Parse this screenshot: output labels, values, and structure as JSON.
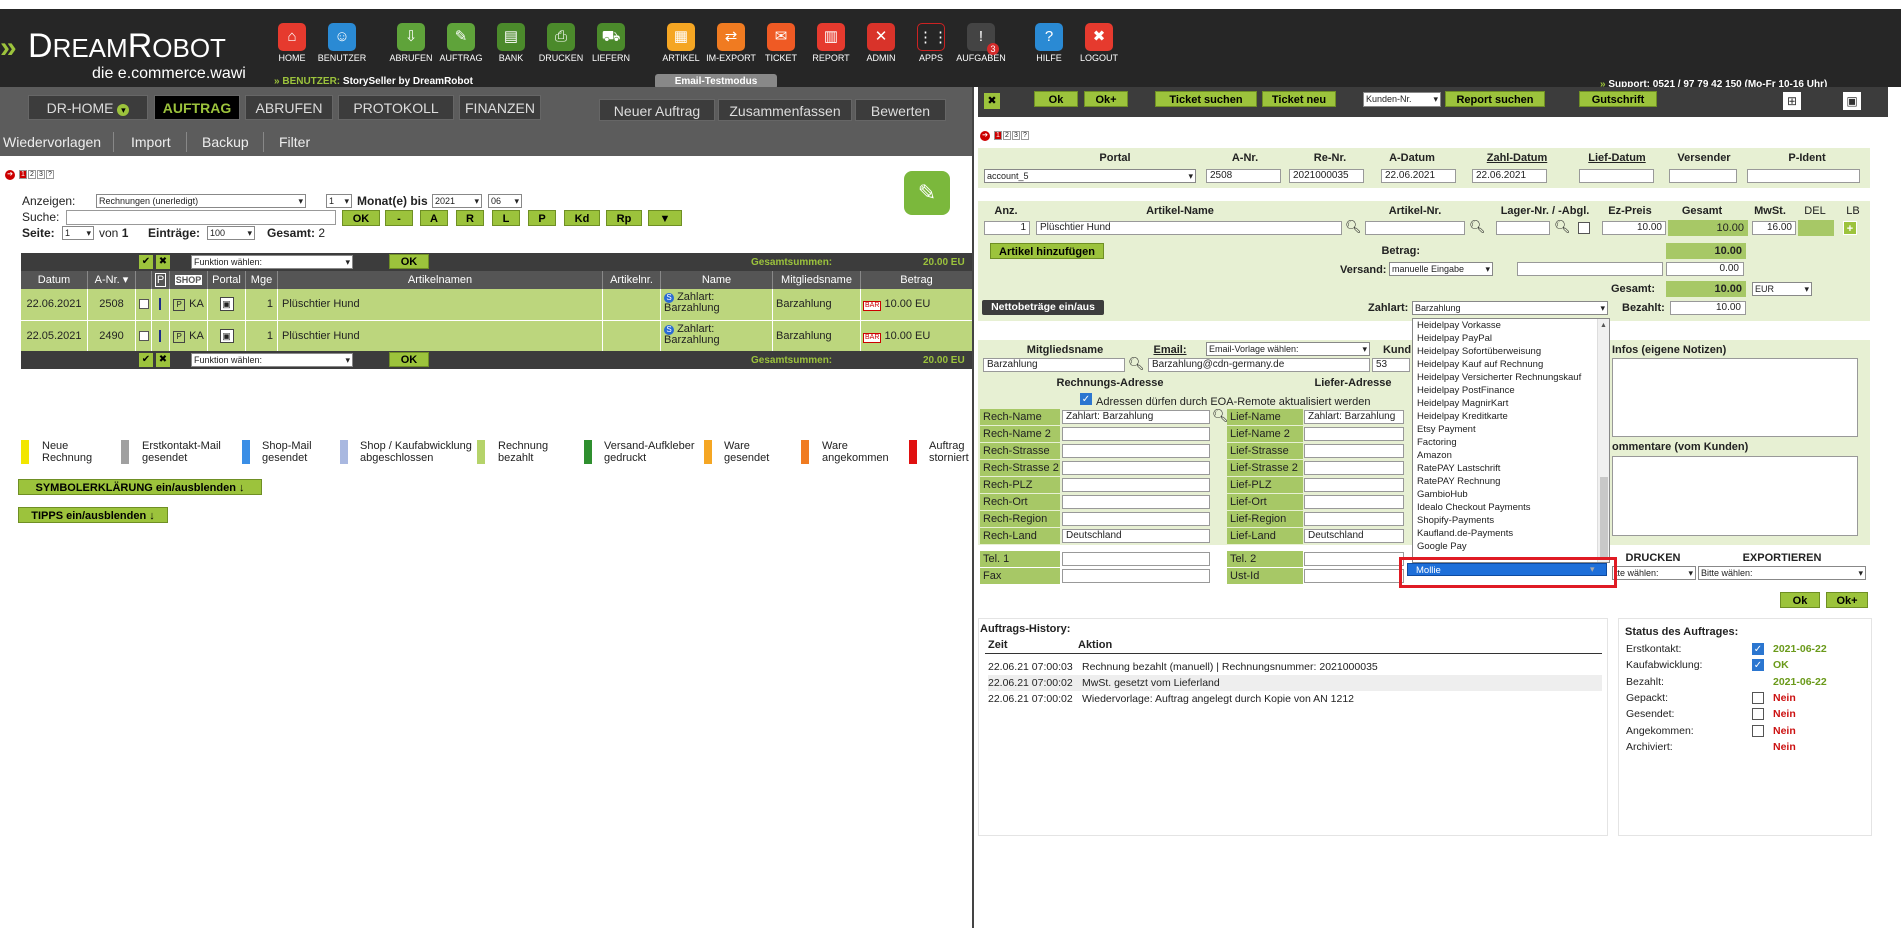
{
  "brand": {
    "name_a": "D",
    "name_b": "REAM",
    "name_c": "R",
    "name_d": "OBOT",
    "tagline": "die e.commerce.wawi"
  },
  "nav": [
    {
      "label": "HOME",
      "icon": "home-icon"
    },
    {
      "label": "BENUTZER",
      "icon": "user-icon"
    },
    {
      "label": "ABRUFEN",
      "icon": "download-icon"
    },
    {
      "label": "AUFTRAG",
      "icon": "order-icon"
    },
    {
      "label": "BANK",
      "icon": "bank-icon"
    },
    {
      "label": "DRUCKEN",
      "icon": "printer-icon"
    },
    {
      "label": "LIEFERN",
      "icon": "cart-icon"
    },
    {
      "label": "ARTIKEL",
      "icon": "boxes-icon"
    },
    {
      "label": "IM-EXPORT",
      "icon": "transfer-icon"
    },
    {
      "label": "TICKET",
      "icon": "mail-icon"
    },
    {
      "label": "REPORT",
      "icon": "chart-icon"
    },
    {
      "label": "ADMIN",
      "icon": "tools-icon"
    },
    {
      "label": "APPS",
      "icon": "apps-icon"
    },
    {
      "label": "AUFGABEN",
      "icon": "tasks-icon",
      "badge": "3"
    },
    {
      "label": "HILFE",
      "icon": "help-icon"
    },
    {
      "label": "LOGOUT",
      "icon": "logout-icon"
    }
  ],
  "benutzer": {
    "prefix": "BENUTZER:",
    "value": "StorySeller by DreamRobot"
  },
  "email_testmodus": "Email-Testmodus",
  "support": "Support: 0521 / 97 79 42 150 (Mo-Fr 10-16 Uhr)",
  "menu1": [
    "DR-HOME",
    "AUFTRAG",
    "ABRUFEN",
    "PROTOKOLL",
    "FINANZEN"
  ],
  "menu1_right": [
    "Neuer Auftrag",
    "Zusammenfassen",
    "Bewerten"
  ],
  "menu2": [
    "Wiedervorlagen",
    "Import",
    "Backup",
    "Filter"
  ],
  "pages": [
    "1",
    "2",
    "3",
    "?"
  ],
  "filter": {
    "anzeigen_label": "Anzeigen:",
    "anzeigen_value": "Rechnungen (unerledigt)",
    "monat_value": "1",
    "monat_label": "Monat(e) bis",
    "year": "2021",
    "month": "06",
    "suche_label": "Suche:",
    "buttons": [
      "OK",
      "-",
      "A",
      "R",
      "L",
      "P",
      "Kd",
      "Rp"
    ],
    "seite_label": "Seite:",
    "seite_value": "1",
    "von_label": "von",
    "von_value": "1",
    "eintraege_label": "Einträge:",
    "eintraege_value": "100",
    "gesamt_label": "Gesamt:",
    "gesamt_value": "2"
  },
  "table": {
    "funktion": "Funktion wählen:",
    "ok": "OK",
    "gesamtsummen_label": "Gesamtsummen:",
    "gesamtsummen_value": "20.00 EU",
    "headers": [
      "Datum",
      "A-Nr.",
      "",
      "P",
      "SHOP",
      "Portal",
      "Mge",
      "Artikelnamen",
      "Artikelnr.",
      "Name",
      "Mitgliedsname",
      "Betrag"
    ],
    "rows": [
      {
        "datum": "22.06.2021",
        "anr": "2508",
        "shop": "KA",
        "mge": "1",
        "artikel": "Plüschtier Hund",
        "artikelnr": "",
        "name_a": "Zahlart:",
        "name_b": "Barzahlung",
        "mitglied": "Barzahlung",
        "bar": "BAR",
        "betrag": "10.00 EU"
      },
      {
        "datum": "22.05.2021",
        "anr": "2490",
        "shop": "KA",
        "mge": "1",
        "artikel": "Plüschtier Hund",
        "artikelnr": "",
        "name_a": "Zahlart:",
        "name_b": "Barzahlung",
        "mitglied": "Barzahlung",
        "bar": "BAR",
        "betrag": "10.00 EU"
      }
    ]
  },
  "legend": [
    {
      "a": "Neue",
      "b": "Rechnung",
      "color": "#f2e600"
    },
    {
      "a": "Erstkontakt-Mail",
      "b": "gesendet",
      "color": "#a0a0a0"
    },
    {
      "a": "Shop-Mail",
      "b": "gesendet",
      "color": "#3a8ee6"
    },
    {
      "a": "Shop / Kaufabwicklung",
      "b": "abgeschlossen",
      "color": "#a9b8e0"
    },
    {
      "a": "Rechnung",
      "b": "bezahlt",
      "color": "#b5d36a"
    },
    {
      "a": "Versand-Aufkleber",
      "b": "gedruckt",
      "color": "#2f8f2f"
    },
    {
      "a": "Ware",
      "b": "gesendet",
      "color": "#f5a623"
    },
    {
      "a": "Ware",
      "b": "angekommen",
      "color": "#f07b21"
    },
    {
      "a": "Auftrag",
      "b": "storniert",
      "color": "#e01010"
    }
  ],
  "toggle_symbol": "SYMBOLERKLÄRUNG ein/ausblenden ↓",
  "toggle_tipps": "TIPPS ein/ausblenden ↓",
  "right": {
    "toolbar": [
      "Ok",
      "Ok+",
      "Ticket suchen",
      "Ticket neu",
      "Report suchen",
      "Gutschrift"
    ],
    "kunden_select": "Kunden-Nr.",
    "head1": [
      "Portal",
      "A-Nr.",
      "Re-Nr.",
      "A-Datum",
      "Zahl-Datum",
      "Lief-Datum",
      "Versender",
      "P-Ident"
    ],
    "portal_value": "account_5",
    "anr_value": "2508",
    "renr_value": "2021000035",
    "adatum_value": "22.06.2021",
    "zahldatum_value": "22.06.2021",
    "head2": [
      "Anz.",
      "Artikel-Name",
      "Artikel-Nr.",
      "Lager-Nr. / -Abgl.",
      "Ez-Preis",
      "Gesamt",
      "MwSt.",
      "DEL",
      "LB"
    ],
    "anz_value": "1",
    "artname_value": "Plüschtier Hund",
    "ezpreis_value": "10.00",
    "gesamt_value": "10.00",
    "mwst_value": "16.00",
    "artikel_hinzufuegen": "Artikel hinzufügen",
    "betrag_label": "Betrag:",
    "betrag_value": "10.00",
    "versand_label": "Versand:",
    "versand_select": "manuelle Eingabe",
    "versand_value": "0.00",
    "gesamt_label": "Gesamt:",
    "gesamt2_value": "10.00",
    "currency": "EUR",
    "netto_btn": "Nettobeträge ein/aus",
    "zahlart_label": "Zahlart:",
    "zahlart_value": "Barzahlung",
    "bezahlt_label": "Bezahlt:",
    "bezahlt_value": "10.00",
    "mitgliedsname_label": "Mitgliedsname",
    "mitgliedsname_value": "Barzahlung",
    "email_label": "Email:",
    "email_select": "Email-Vorlage wählen:",
    "email_value": "Barzahlung@cdn-germany.de",
    "kund_label": "Kund",
    "kund_value": "53",
    "infos_label": "Infos (eigene Notizen)",
    "kommentare_label": "ommentare (vom Kunden)",
    "rechnungs_adresse": "Rechnungs-Adresse",
    "liefer_adresse": "Liefer-Adresse",
    "eoa_text": "Adressen dürfen durch EOA-Remote aktualisiert werden",
    "rech_fields": [
      {
        "label": "Rech-Name",
        "value": "Zahlart: Barzahlung"
      },
      {
        "label": "Rech-Name 2",
        "value": ""
      },
      {
        "label": "Rech-Strasse",
        "value": ""
      },
      {
        "label": "Rech-Strasse 2",
        "value": ""
      },
      {
        "label": "Rech-PLZ",
        "value": ""
      },
      {
        "label": "Rech-Ort",
        "value": ""
      },
      {
        "label": "Rech-Region",
        "value": ""
      },
      {
        "label": "Rech-Land",
        "value": "Deutschland"
      }
    ],
    "lief_fields": [
      {
        "label": "Lief-Name",
        "value": "Zahlart: Barzahlung"
      },
      {
        "label": "Lief-Name 2",
        "value": ""
      },
      {
        "label": "Lief-Strasse",
        "value": ""
      },
      {
        "label": "Lief-Strasse 2",
        "value": ""
      },
      {
        "label": "Lief-PLZ",
        "value": ""
      },
      {
        "label": "Lief-Ort",
        "value": ""
      },
      {
        "label": "Lief-Region",
        "value": ""
      },
      {
        "label": "Lief-Land",
        "value": "Deutschland"
      }
    ],
    "tel1_label": "Tel. 1",
    "tel2_label": "Tel. 2",
    "fax_label": "Fax",
    "ustid_label": "Ust-Id",
    "drucken_label": "DRUCKEN",
    "exportieren_label": "EXPORTIEREN",
    "bitte_waehlen": "Bitte wählen:",
    "bitte_waehlen_short": "tte wählen:",
    "ok": "Ok",
    "okplus": "Ok+",
    "zahlart_options": [
      "Heidelpay Vorkasse",
      "Heidelpay PayPal",
      "Heidelpay Sofortüberweisung",
      "Heidelpay Kauf auf Rechnung",
      "Heidelpay Versicherter Rechnungskauf",
      "Heidelpay PostFinance",
      "Heidelpay MagnirKart",
      "Heidelpay Kreditkarte",
      "Etsy Payment",
      "Factoring",
      "Amazon",
      "RatePAY Lastschrift",
      "RatePAY Rechnung",
      "GambioHub",
      "Idealo Checkout Payments",
      "Shopify-Payments",
      "Kaufland.de-Payments",
      "Google Pay"
    ],
    "selected_option": "Mollie",
    "history_title": "Auftrags-History:",
    "history_cols": [
      "Zeit",
      "Aktion"
    ],
    "history": [
      {
        "zeit": "22.06.21 07:00:03",
        "aktion": "Rechnung bezahlt (manuell) | Rechnungsnummer: 2021000035"
      },
      {
        "zeit": "22.06.21 07:00:02",
        "aktion": "MwSt. gesetzt vom Lieferland"
      },
      {
        "zeit": "22.06.21 07:00:02",
        "aktion": "Wiedervorlage: Auftrag angelegt durch Kopie von AN 1212"
      }
    ],
    "status_title": "Status des Auftrages:",
    "status": [
      {
        "label": "Erstkontakt:",
        "checked": true,
        "value": "2021-06-22",
        "color": "#6a9a1a"
      },
      {
        "label": "Kaufabwicklung:",
        "checked": true,
        "value": "OK",
        "color": "#6a9a1a"
      },
      {
        "label": "Bezahlt:",
        "checked": null,
        "value": "2021-06-22",
        "color": "#6a9a1a"
      },
      {
        "label": "Gepackt:",
        "checked": false,
        "value": "Nein",
        "color": "#cc1111"
      },
      {
        "label": "Gesendet:",
        "checked": false,
        "value": "Nein",
        "color": "#cc1111"
      },
      {
        "label": "Angekommen:",
        "checked": false,
        "value": "Nein",
        "color": "#cc1111"
      },
      {
        "label": "Archiviert:",
        "checked": null,
        "value": "Nein",
        "color": "#cc1111"
      }
    ]
  }
}
